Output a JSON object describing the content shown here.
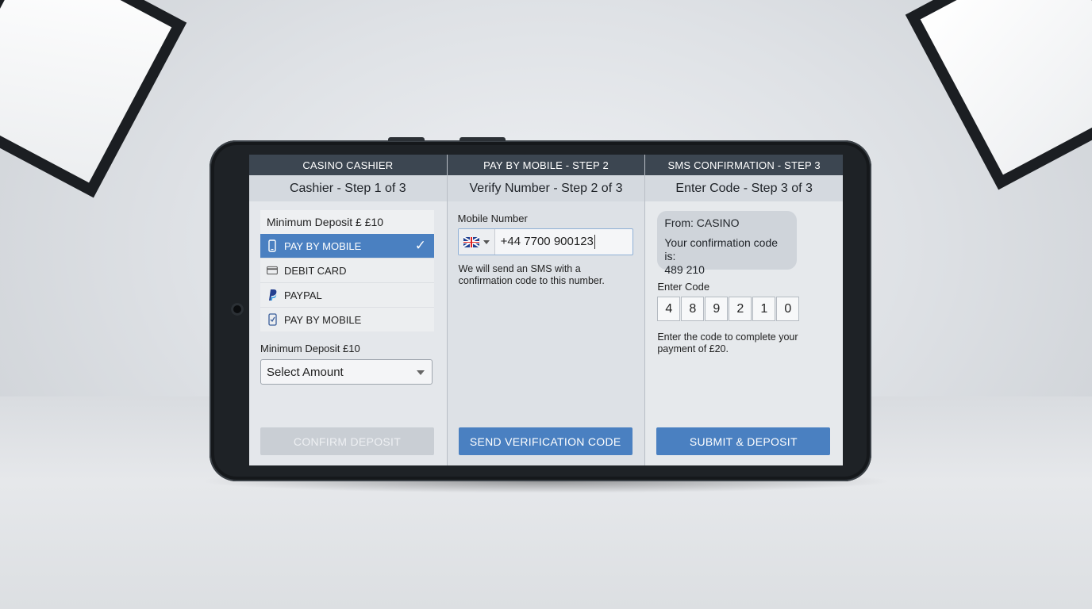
{
  "screen": {
    "step1": {
      "header": "CASINO CASHIER",
      "subtitle": "Cashier - Step 1 of 3",
      "method_list_title": "Minimum Deposit £ £10",
      "methods": [
        {
          "label": "PAY BY MOBILE",
          "icon": "mobile-phone-icon",
          "selected": true
        },
        {
          "label": "DEBIT CARD",
          "icon": "credit-card-icon",
          "selected": false
        },
        {
          "label": "PAYPAL",
          "icon": "paypal-icon",
          "selected": false
        },
        {
          "label": "PAY BY MOBILE",
          "icon": "checked-phone-icon",
          "selected": false
        }
      ],
      "amount_label": "Minimum Deposit £10",
      "amount_select": "Select Amount",
      "confirm_button": "CONFIRM DEPOSIT"
    },
    "step2": {
      "header": "PAY BY MOBILE - STEP 2",
      "subtitle": "Verify Number - Step 2 of 3",
      "mobile_label": "Mobile Number",
      "country_flag": "uk-flag-icon",
      "phone_value": "+44 7700 900123",
      "hint": "We will send an SMS with a confirmation code to this number.",
      "send_button": "SEND VERIFICATION CODE"
    },
    "step3": {
      "header": "SMS CONFIRMATION - STEP 3",
      "subtitle": "Enter Code - Step 3 of 3",
      "sms_from": "From: CASINO",
      "sms_text": "Your confirmation code is:",
      "sms_code": "489 210",
      "code_label": "Enter Code",
      "code_digits": [
        "4",
        "8",
        "9",
        "2",
        "1",
        "0"
      ],
      "hint": "Enter the code to complete your payment of £20.",
      "submit_button": "SUBMIT & DEPOSIT"
    }
  },
  "colors": {
    "accent": "#4a80c1",
    "header_bg": "#3c4651",
    "disabled": "#c9ced4"
  }
}
